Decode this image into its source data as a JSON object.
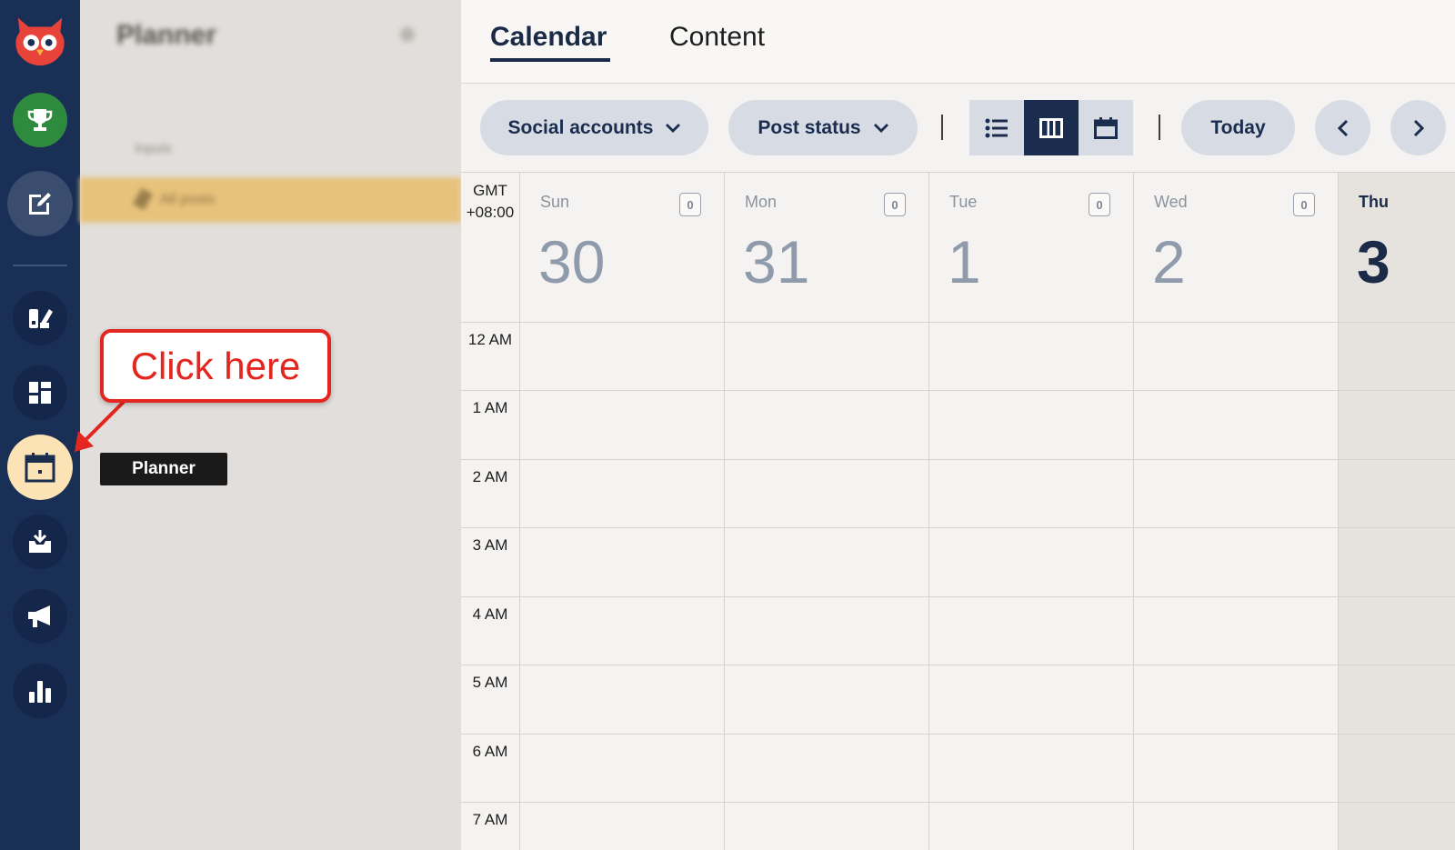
{
  "sidebar": {
    "title": "Planner",
    "section": "Inputs",
    "item": "All posts"
  },
  "tabs": [
    {
      "label": "Calendar",
      "active": true
    },
    {
      "label": "Content",
      "active": false
    }
  ],
  "toolbar": {
    "social_accounts": "Social accounts",
    "post_status": "Post status",
    "today": "Today",
    "view_icons": [
      "list-view-icon",
      "week-view-icon",
      "month-view-icon"
    ],
    "active_view": "week-view-icon"
  },
  "calendar": {
    "timezone_line1": "GMT",
    "timezone_line2": "+08:00",
    "days": [
      {
        "name": "Sun",
        "date": "30",
        "count": "0"
      },
      {
        "name": "Mon",
        "date": "31",
        "count": "0"
      },
      {
        "name": "Tue",
        "date": "1",
        "count": "0"
      },
      {
        "name": "Wed",
        "date": "2",
        "count": "0"
      },
      {
        "name": "Thu",
        "date": "3",
        "today": true
      }
    ],
    "hours": [
      "12 AM",
      "1 AM",
      "2 AM",
      "3 AM",
      "4 AM",
      "5 AM",
      "6 AM",
      "7 AM"
    ]
  },
  "rail": {
    "icons": [
      "owl-logo-icon",
      "trophy-icon",
      "compose-icon",
      "assets-icon",
      "dashboard-icon",
      "planner-icon",
      "inbox-icon",
      "megaphone-icon",
      "analytics-icon"
    ],
    "active": "planner-icon"
  },
  "tooltip": "Planner",
  "callout": "Click here",
  "colors": {
    "rail": "#1a2f55",
    "accent": "#1b2d4f",
    "callout": "#e3261f",
    "planner_active": "#fbe3b5",
    "trophy": "#2e8b3e",
    "owl": "#e8433a"
  }
}
